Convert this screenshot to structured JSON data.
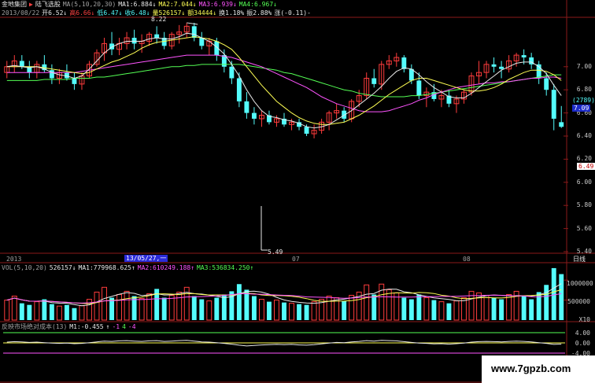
{
  "header": {
    "stock_name": "金地集团",
    "stock_suffix": "陆飞选股",
    "ma_legend": "MA(5,10,20,30)",
    "ma1": "MA1:6.884↓",
    "ma2": "MA2:7.044↓",
    "ma3": "MA3:6.939↓",
    "ma4": "MA4:6.967↓"
  },
  "quote": {
    "date": "2013/08/22",
    "open": "开6.52↓",
    "high": "高6.66↓",
    "low": "低6.47↓",
    "close": "收6.48↓",
    "volume": "量526157↓",
    "amount": "额34444↓",
    "turnover": "换1.18%",
    "amplitude": "振2.88%",
    "change": "涨(-0.11)-"
  },
  "price_panel": {
    "y_ticks": [
      "7.00",
      "6.80",
      "6.60",
      "6.40",
      "6.20",
      "6.00",
      "5.80",
      "5.60",
      "5.40"
    ],
    "right_top_badge": "(2789)",
    "right_top_value": "7.09",
    "current_price": "6.49",
    "high_marker": "8.22",
    "low_marker": "5.49"
  },
  "time_axis": {
    "labels": [
      "2013",
      "07",
      "08"
    ],
    "cursor_date": "13/05/27,一",
    "period_label": "日线"
  },
  "volume_panel": {
    "title": "VOL(5,10,20)",
    "vol": "526157↓",
    "ma1": "MA1:779968.625↑",
    "ma2": "MA2:610249.188↑",
    "ma3": "MA3:536834.250↑",
    "y_ticks": [
      "1000000",
      "500000"
    ],
    "unit": "X10"
  },
  "indicator_panel": {
    "title": "反映市场绝对成本(13)",
    "m1": "M1:-0.455",
    "v1": "↑",
    "v2": "-1",
    "v3": "4",
    "v4": "-4",
    "y_ticks": [
      "4.00",
      "0.00",
      "-4.00"
    ]
  },
  "watermark": "www.7gpzb.com",
  "colors": {
    "up": "#ff3c3c",
    "down": "#54fcfc",
    "ma5": "#e8e8e8",
    "ma10": "#ffff54",
    "ma20": "#ff54ff",
    "ma30": "#54ff54",
    "grid": "#8b1a1a"
  },
  "chart_data": [
    {
      "type": "candlestick",
      "title": "",
      "note": "daily candles, approx values read off the price axis",
      "ylim": [
        5.4,
        7.4
      ],
      "candles": [
        {
          "o": 6.95,
          "h": 7.05,
          "l": 6.9,
          "c": 7.0
        },
        {
          "o": 7.0,
          "h": 7.1,
          "l": 6.95,
          "c": 7.05
        },
        {
          "o": 7.05,
          "h": 7.1,
          "l": 6.98,
          "c": 7.0
        },
        {
          "o": 7.0,
          "h": 7.05,
          "l": 6.9,
          "c": 6.95
        },
        {
          "o": 6.95,
          "h": 7.05,
          "l": 6.9,
          "c": 7.02
        },
        {
          "o": 7.02,
          "h": 7.1,
          "l": 6.95,
          "c": 6.97
        },
        {
          "o": 6.97,
          "h": 7.02,
          "l": 6.85,
          "c": 6.9
        },
        {
          "o": 6.9,
          "h": 6.98,
          "l": 6.85,
          "c": 6.95
        },
        {
          "o": 6.95,
          "h": 7.02,
          "l": 6.88,
          "c": 6.9
        },
        {
          "o": 6.9,
          "h": 6.95,
          "l": 6.8,
          "c": 6.85
        },
        {
          "o": 6.85,
          "h": 6.95,
          "l": 6.8,
          "c": 6.92
        },
        {
          "o": 6.92,
          "h": 7.05,
          "l": 6.9,
          "c": 7.02
        },
        {
          "o": 7.02,
          "h": 7.15,
          "l": 7.0,
          "c": 7.12
        },
        {
          "o": 7.12,
          "h": 7.25,
          "l": 7.05,
          "c": 7.2
        },
        {
          "o": 7.2,
          "h": 7.3,
          "l": 7.1,
          "c": 7.15
        },
        {
          "o": 7.15,
          "h": 7.25,
          "l": 7.1,
          "c": 7.2
        },
        {
          "o": 7.2,
          "h": 7.3,
          "l": 7.15,
          "c": 7.25
        },
        {
          "o": 7.25,
          "h": 7.32,
          "l": 7.15,
          "c": 7.2
        },
        {
          "o": 7.2,
          "h": 7.28,
          "l": 7.12,
          "c": 7.22
        },
        {
          "o": 7.22,
          "h": 7.3,
          "l": 7.18,
          "c": 7.28
        },
        {
          "o": 7.28,
          "h": 7.35,
          "l": 7.2,
          "c": 7.25
        },
        {
          "o": 7.25,
          "h": 7.3,
          "l": 7.15,
          "c": 7.18
        },
        {
          "o": 7.18,
          "h": 7.3,
          "l": 7.15,
          "c": 7.28
        },
        {
          "o": 7.28,
          "h": 7.36,
          "l": 7.2,
          "c": 7.3
        },
        {
          "o": 7.3,
          "h": 7.38,
          "l": 7.25,
          "c": 7.35
        },
        {
          "o": 7.35,
          "h": 7.38,
          "l": 7.22,
          "c": 7.25
        },
        {
          "o": 7.25,
          "h": 7.3,
          "l": 7.15,
          "c": 7.18
        },
        {
          "o": 7.18,
          "h": 7.25,
          "l": 7.1,
          "c": 7.22
        },
        {
          "o": 7.22,
          "h": 7.25,
          "l": 7.05,
          "c": 7.1
        },
        {
          "o": 7.1,
          "h": 7.15,
          "l": 6.95,
          "c": 7.0
        },
        {
          "o": 7.0,
          "h": 7.05,
          "l": 6.85,
          "c": 6.9
        },
        {
          "o": 6.9,
          "h": 6.95,
          "l": 6.65,
          "c": 6.7
        },
        {
          "o": 6.7,
          "h": 6.78,
          "l": 6.55,
          "c": 6.6
        },
        {
          "o": 6.6,
          "h": 6.65,
          "l": 6.5,
          "c": 6.55
        },
        {
          "o": 6.55,
          "h": 6.62,
          "l": 6.48,
          "c": 6.58
        },
        {
          "o": 6.58,
          "h": 6.62,
          "l": 6.5,
          "c": 6.52
        },
        {
          "o": 6.52,
          "h": 6.58,
          "l": 6.48,
          "c": 6.55
        },
        {
          "o": 6.55,
          "h": 6.6,
          "l": 6.48,
          "c": 6.5
        },
        {
          "o": 6.5,
          "h": 6.55,
          "l": 6.45,
          "c": 6.52
        },
        {
          "o": 6.52,
          "h": 6.55,
          "l": 6.45,
          "c": 6.48
        },
        {
          "o": 6.48,
          "h": 6.5,
          "l": 6.4,
          "c": 6.42
        },
        {
          "o": 6.42,
          "h": 6.5,
          "l": 6.38,
          "c": 6.45
        },
        {
          "o": 6.45,
          "h": 6.55,
          "l": 6.42,
          "c": 6.52
        },
        {
          "o": 6.52,
          "h": 6.62,
          "l": 6.45,
          "c": 6.6
        },
        {
          "o": 6.6,
          "h": 6.68,
          "l": 6.55,
          "c": 6.62
        },
        {
          "o": 6.62,
          "h": 6.65,
          "l": 6.52,
          "c": 6.55
        },
        {
          "o": 6.55,
          "h": 6.72,
          "l": 6.52,
          "c": 6.7
        },
        {
          "o": 6.7,
          "h": 6.8,
          "l": 6.65,
          "c": 6.75
        },
        {
          "o": 6.75,
          "h": 6.95,
          "l": 6.72,
          "c": 6.9
        },
        {
          "o": 6.9,
          "h": 6.98,
          "l": 6.82,
          "c": 6.85
        },
        {
          "o": 6.85,
          "h": 7.05,
          "l": 6.8,
          "c": 7.02
        },
        {
          "o": 7.02,
          "h": 7.1,
          "l": 6.98,
          "c": 7.05
        },
        {
          "o": 7.05,
          "h": 7.12,
          "l": 7.0,
          "c": 7.08
        },
        {
          "o": 7.08,
          "h": 7.1,
          "l": 6.95,
          "c": 6.98
        },
        {
          "o": 6.98,
          "h": 7.02,
          "l": 6.85,
          "c": 6.88
        },
        {
          "o": 6.88,
          "h": 6.95,
          "l": 6.72,
          "c": 6.75
        },
        {
          "o": 6.75,
          "h": 6.82,
          "l": 6.65,
          "c": 6.78
        },
        {
          "o": 6.78,
          "h": 6.85,
          "l": 6.7,
          "c": 6.72
        },
        {
          "o": 6.72,
          "h": 6.8,
          "l": 6.65,
          "c": 6.75
        },
        {
          "o": 6.75,
          "h": 6.8,
          "l": 6.65,
          "c": 6.68
        },
        {
          "o": 6.68,
          "h": 6.75,
          "l": 6.6,
          "c": 6.72
        },
        {
          "o": 6.72,
          "h": 6.8,
          "l": 6.68,
          "c": 6.78
        },
        {
          "o": 6.78,
          "h": 6.95,
          "l": 6.75,
          "c": 6.92
        },
        {
          "o": 6.92,
          "h": 7.05,
          "l": 6.85,
          "c": 6.95
        },
        {
          "o": 6.95,
          "h": 7.05,
          "l": 6.9,
          "c": 7.02
        },
        {
          "o": 7.02,
          "h": 7.08,
          "l": 6.95,
          "c": 7.0
        },
        {
          "o": 7.0,
          "h": 7.05,
          "l": 6.9,
          "c": 6.98
        },
        {
          "o": 6.98,
          "h": 7.1,
          "l": 6.95,
          "c": 7.05
        },
        {
          "o": 7.05,
          "h": 7.12,
          "l": 7.0,
          "c": 7.1
        },
        {
          "o": 7.1,
          "h": 7.15,
          "l": 7.02,
          "c": 7.08
        },
        {
          "o": 7.08,
          "h": 7.12,
          "l": 6.98,
          "c": 7.02
        },
        {
          "o": 7.02,
          "h": 7.05,
          "l": 6.85,
          "c": 6.9
        },
        {
          "o": 6.9,
          "h": 6.95,
          "l": 6.75,
          "c": 6.8
        },
        {
          "o": 6.8,
          "h": 6.85,
          "l": 6.45,
          "c": 6.55
        },
        {
          "o": 6.52,
          "h": 6.66,
          "l": 6.47,
          "c": 6.48
        }
      ],
      "ma5": [
        7.0,
        7.01,
        7.0,
        6.99,
        7.0,
        6.98,
        6.95,
        6.93,
        6.92,
        6.9,
        6.92,
        6.98,
        7.05,
        7.12,
        7.17,
        7.2,
        7.22,
        7.22,
        7.22,
        7.24,
        7.25,
        7.24,
        7.24,
        7.26,
        7.29,
        7.28,
        7.25,
        7.22,
        7.17,
        7.11,
        7.02,
        6.92,
        6.8,
        6.7,
        6.62,
        6.57,
        6.56,
        6.54,
        6.53,
        6.51,
        6.48,
        6.47,
        6.48,
        6.5,
        6.54,
        6.58,
        6.62,
        6.67,
        6.72,
        6.77,
        6.83,
        6.9,
        6.96,
        6.99,
        6.98,
        6.93,
        6.87,
        6.82,
        6.78,
        6.74,
        6.73,
        6.73,
        6.77,
        6.82,
        6.87,
        6.92,
        6.97,
        7.0,
        7.03,
        7.04,
        7.04,
        7.0,
        6.94,
        6.84,
        6.75
      ],
      "ma10": [
        7.0,
        7.0,
        7.0,
        7.0,
        7.0,
        6.99,
        6.98,
        6.97,
        6.96,
        6.95,
        6.94,
        6.95,
        6.98,
        7.01,
        7.04,
        7.06,
        7.09,
        7.12,
        7.16,
        7.19,
        7.21,
        7.22,
        7.23,
        7.24,
        7.25,
        7.26,
        7.25,
        7.24,
        7.22,
        7.19,
        7.15,
        7.08,
        7.0,
        6.92,
        6.84,
        6.77,
        6.7,
        6.65,
        6.6,
        6.56,
        6.53,
        6.51,
        6.5,
        6.5,
        6.51,
        6.52,
        6.55,
        6.58,
        6.62,
        6.66,
        6.71,
        6.76,
        6.8,
        6.84,
        6.88,
        6.9,
        6.9,
        6.88,
        6.86,
        6.84,
        6.82,
        6.8,
        6.79,
        6.79,
        6.8,
        6.82,
        6.85,
        6.89,
        6.92,
        6.95,
        6.97,
        6.97,
        6.96,
        6.93,
        6.88
      ],
      "ma20": [
        6.95,
        6.95,
        6.95,
        6.95,
        6.95,
        6.95,
        6.95,
        6.95,
        6.95,
        6.95,
        6.96,
        6.97,
        6.98,
        6.99,
        7.0,
        7.01,
        7.02,
        7.03,
        7.04,
        7.05,
        7.06,
        7.07,
        7.08,
        7.09,
        7.1,
        7.1,
        7.1,
        7.1,
        7.1,
        7.09,
        7.08,
        7.06,
        7.04,
        7.02,
        7.0,
        6.97,
        6.94,
        6.91,
        6.88,
        6.85,
        6.82,
        6.78,
        6.74,
        6.71,
        6.68,
        6.66,
        6.64,
        6.62,
        6.61,
        6.61,
        6.61,
        6.62,
        6.64,
        6.66,
        6.68,
        6.71,
        6.73,
        6.76,
        6.78,
        6.8,
        6.82,
        6.83,
        6.84,
        6.85,
        6.86,
        6.86,
        6.87,
        6.87,
        6.88,
        6.89,
        6.9,
        6.9,
        6.91,
        6.91,
        6.9
      ],
      "ma30": [
        6.88,
        6.88,
        6.88,
        6.88,
        6.88,
        6.89,
        6.89,
        6.89,
        6.89,
        6.9,
        6.9,
        6.9,
        6.91,
        6.91,
        6.92,
        6.93,
        6.94,
        6.95,
        6.96,
        6.97,
        6.98,
        6.99,
        7.0,
        7.0,
        7.01,
        7.01,
        7.02,
        7.02,
        7.02,
        7.02,
        7.02,
        7.02,
        7.01,
        7.0,
        6.99,
        6.98,
        6.97,
        6.95,
        6.94,
        6.92,
        6.9,
        6.88,
        6.86,
        6.84,
        6.82,
        6.8,
        6.79,
        6.77,
        6.76,
        6.75,
        6.74,
        6.74,
        6.74,
        6.74,
        6.75,
        6.75,
        6.76,
        6.77,
        6.78,
        6.79,
        6.8,
        6.81,
        6.82,
        6.83,
        6.84,
        6.85,
        6.86,
        6.87,
        6.88,
        6.89,
        6.9,
        6.91,
        6.92,
        6.93,
        6.93
      ]
    },
    {
      "type": "bar",
      "title": "VOL(5,10,20)",
      "ylim": [
        0,
        1200000
      ],
      "values": [
        500000,
        600000,
        420000,
        380000,
        460000,
        520000,
        400000,
        350000,
        380000,
        300000,
        360000,
        520000,
        700000,
        820000,
        560000,
        640000,
        720000,
        600000,
        540000,
        660000,
        780000,
        560000,
        620000,
        700000,
        820000,
        600000,
        520000,
        480000,
        560000,
        640000,
        720000,
        900000,
        760000,
        600000,
        520000,
        460000,
        500000,
        440000,
        420000,
        400000,
        380000,
        460000,
        520000,
        600000,
        560000,
        480000,
        620000,
        700000,
        880000,
        640000,
        900000,
        760000,
        680000,
        560000,
        520000,
        640000,
        560000,
        500000,
        460000,
        420000,
        480000,
        560000,
        720000,
        680000,
        620000,
        560000,
        520000,
        640000,
        720000,
        600000,
        520000,
        700000,
        880000,
        1300000,
        1150000
      ]
    },
    {
      "type": "line",
      "title": "反映市场绝对成本(13)",
      "ylim": [
        -4,
        4
      ],
      "values": [
        0.3,
        0.5,
        0.4,
        0.2,
        0.3,
        0.1,
        -0.1,
        -0.2,
        -0.1,
        -0.3,
        -0.2,
        0.1,
        0.4,
        0.7,
        0.6,
        0.8,
        0.9,
        0.7,
        0.6,
        0.8,
        0.9,
        0.6,
        0.7,
        0.9,
        1.0,
        0.7,
        0.4,
        0.3,
        0.1,
        -0.2,
        -0.5,
        -0.9,
        -1.2,
        -1.0,
        -0.8,
        -0.7,
        -0.6,
        -0.7,
        -0.6,
        -0.8,
        -0.9,
        -0.7,
        -0.4,
        -0.1,
        0.2,
        0.1,
        0.4,
        0.6,
        0.9,
        0.7,
        1.0,
        0.9,
        0.8,
        0.5,
        0.2,
        -0.1,
        -0.2,
        -0.4,
        -0.3,
        -0.5,
        -0.3,
        -0.1,
        0.3,
        0.5,
        0.6,
        0.5,
        0.4,
        0.6,
        0.7,
        0.6,
        0.4,
        0.1,
        -0.2,
        -0.6,
        -0.46
      ]
    }
  ]
}
